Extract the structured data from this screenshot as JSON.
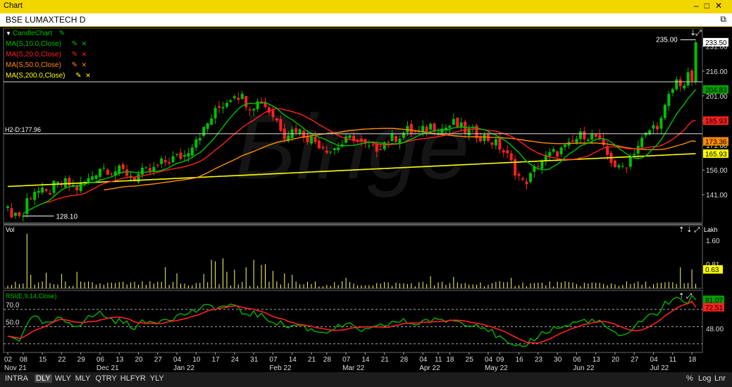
{
  "window": {
    "title": "Chart",
    "controls": [
      "–",
      "□",
      "✕"
    ]
  },
  "symbol": {
    "label": "BSE LUMAXTECH D"
  },
  "legend": [
    {
      "label": "CandleChart",
      "color": "#00c000"
    },
    {
      "label": "MA(S,10.0,Close)",
      "color": "#00c000"
    },
    {
      "label": "MA(S,20.0,Close)",
      "color": "#ff2020"
    },
    {
      "label": "MA(S,50.0,Close)",
      "color": "#ff8c00"
    },
    {
      "label": "MA(S,200.0,Close)",
      "color": "#ffff00"
    }
  ],
  "panels": {
    "volume": {
      "label": "Vol",
      "unit": "Lakh"
    },
    "rsi": {
      "label": "RSI(E,9,14,Close)"
    }
  },
  "watermark": "Binge",
  "chart_data": [
    {
      "type": "candlestick",
      "axis": {
        "ylim": [
          124,
          242
        ],
        "ticks": [
          141.0,
          156.0,
          171.0,
          186.0,
          201.0,
          216.0,
          231.0
        ]
      },
      "date_labels": [
        {
          "i": 0,
          "d": "02",
          "m": "Nov 21"
        },
        {
          "i": 4,
          "d": "08"
        },
        {
          "i": 9,
          "d": "15"
        },
        {
          "i": 14,
          "d": "22"
        },
        {
          "i": 19,
          "d": "29"
        },
        {
          "i": 24,
          "d": "06",
          "m": "Dec 21"
        },
        {
          "i": 29,
          "d": "13"
        },
        {
          "i": 34,
          "d": "20"
        },
        {
          "i": 39,
          "d": "27"
        },
        {
          "i": 44,
          "d": "04",
          "m": "Jan 22"
        },
        {
          "i": 49,
          "d": "10"
        },
        {
          "i": 54,
          "d": "17"
        },
        {
          "i": 59,
          "d": "24"
        },
        {
          "i": 64,
          "d": "31"
        },
        {
          "i": 69,
          "d": "07",
          "m": "Feb 22"
        },
        {
          "i": 74,
          "d": "14"
        },
        {
          "i": 79,
          "d": "21"
        },
        {
          "i": 83,
          "d": "28"
        },
        {
          "i": 88,
          "d": "07",
          "m": "Mar 22"
        },
        {
          "i": 93,
          "d": "14"
        },
        {
          "i": 98,
          "d": "21"
        },
        {
          "i": 103,
          "d": "28"
        },
        {
          "i": 108,
          "d": "04",
          "m": "Apr 22"
        },
        {
          "i": 112,
          "d": "11"
        },
        {
          "i": 115,
          "d": "18"
        },
        {
          "i": 120,
          "d": "25"
        },
        {
          "i": 125,
          "d": "04",
          "m": "May 22"
        },
        {
          "i": 128,
          "d": "09"
        },
        {
          "i": 133,
          "d": "16"
        },
        {
          "i": 138,
          "d": "23"
        },
        {
          "i": 143,
          "d": "30"
        },
        {
          "i": 148,
          "d": "06",
          "m": "Jun 22"
        },
        {
          "i": 153,
          "d": "13"
        },
        {
          "i": 158,
          "d": "20"
        },
        {
          "i": 163,
          "d": "27"
        },
        {
          "i": 168,
          "d": "04",
          "m": "Jul 22"
        },
        {
          "i": 173,
          "d": "11"
        },
        {
          "i": 178,
          "d": "18"
        }
      ],
      "annotations": {
        "high_label": "235.00",
        "high_value": 235.0,
        "low_label": "128.10",
        "low_value": 128.1,
        "hline_label": "H2-D:177.96",
        "hline_value": 177.96,
        "hline2_value": 209.5
      },
      "last_values": [
        {
          "label": "233.50",
          "value": 233.5,
          "bg": "#ffffff",
          "fg": "#000000"
        },
        {
          "label": "204.83",
          "value": 204.83,
          "bg": "#00a000",
          "fg": "#000000"
        },
        {
          "label": "185.93",
          "value": 185.93,
          "bg": "#ff2020",
          "fg": "#000000"
        },
        {
          "label": "173.36",
          "value": 173.36,
          "bg": "#ff8c00",
          "fg": "#000000"
        },
        {
          "label": "165.93",
          "value": 165.93,
          "bg": "#ffff00",
          "fg": "#000000"
        }
      ],
      "colors": {
        "up": "#00c000",
        "down": "#ff2020"
      },
      "waypoints": [
        [
          0,
          131
        ],
        [
          3,
          129
        ],
        [
          4,
          128.5
        ],
        [
          5,
          138
        ],
        [
          7,
          144
        ],
        [
          10,
          141
        ],
        [
          12,
          146
        ],
        [
          15,
          148
        ],
        [
          18,
          145
        ],
        [
          21,
          150
        ],
        [
          24,
          158
        ],
        [
          27,
          156
        ],
        [
          30,
          155
        ],
        [
          33,
          152
        ],
        [
          35,
          154
        ],
        [
          38,
          156
        ],
        [
          40,
          160
        ],
        [
          43,
          163
        ],
        [
          46,
          165
        ],
        [
          49,
          176
        ],
        [
          51,
          180
        ],
        [
          53,
          188
        ],
        [
          55,
          194
        ],
        [
          57,
          198
        ],
        [
          59,
          203
        ],
        [
          61,
          200
        ],
        [
          63,
          195
        ],
        [
          66,
          198
        ],
        [
          68,
          192
        ],
        [
          70,
          186
        ],
        [
          72,
          178
        ],
        [
          75,
          181
        ],
        [
          78,
          176
        ],
        [
          81,
          172
        ],
        [
          84,
          168
        ],
        [
          87,
          172
        ],
        [
          90,
          176
        ],
        [
          93,
          170
        ],
        [
          95,
          168
        ],
        [
          98,
          173
        ],
        [
          101,
          176
        ],
        [
          104,
          180
        ],
        [
          107,
          178
        ],
        [
          110,
          183
        ],
        [
          113,
          181
        ],
        [
          116,
          184
        ],
        [
          119,
          180
        ],
        [
          122,
          178
        ],
        [
          125,
          175
        ],
        [
          128,
          170
        ],
        [
          130,
          164
        ],
        [
          132,
          156
        ],
        [
          134,
          148
        ],
        [
          136,
          152
        ],
        [
          138,
          160
        ],
        [
          141,
          165
        ],
        [
          144,
          168
        ],
        [
          146,
          170
        ],
        [
          148,
          175
        ],
        [
          150,
          178
        ],
        [
          153,
          176
        ],
        [
          155,
          168
        ],
        [
          157,
          162
        ],
        [
          159,
          156
        ],
        [
          161,
          160
        ],
        [
          163,
          168
        ],
        [
          165,
          174
        ],
        [
          167,
          180
        ],
        [
          170,
          186
        ],
        [
          172,
          200
        ],
        [
          174,
          210
        ],
        [
          176,
          208
        ],
        [
          177,
          212
        ],
        [
          178,
          233.5
        ]
      ]
    },
    {
      "type": "bar",
      "name": "Vol",
      "axis": {
        "ylim": [
          0,
          1.95
        ],
        "ticks": [
          0.81,
          1.6
        ]
      },
      "last_label": "0.63",
      "last_value": 0.63,
      "spikes": [
        {
          "i": 5,
          "v": 1.82
        },
        {
          "i": 6,
          "v": 0.45
        },
        {
          "i": 10,
          "v": 0.52
        },
        {
          "i": 14,
          "v": 0.48
        },
        {
          "i": 18,
          "v": 0.55
        },
        {
          "i": 41,
          "v": 0.7
        },
        {
          "i": 44,
          "v": 0.5
        },
        {
          "i": 51,
          "v": 0.48
        },
        {
          "i": 53,
          "v": 0.95
        },
        {
          "i": 54,
          "v": 0.9
        },
        {
          "i": 56,
          "v": 1.0
        },
        {
          "i": 57,
          "v": 0.55
        },
        {
          "i": 59,
          "v": 0.62
        },
        {
          "i": 62,
          "v": 0.7
        },
        {
          "i": 64,
          "v": 0.95
        },
        {
          "i": 66,
          "v": 0.78
        },
        {
          "i": 67,
          "v": 0.8
        },
        {
          "i": 69,
          "v": 0.58
        },
        {
          "i": 72,
          "v": 0.5
        },
        {
          "i": 74,
          "v": 0.45
        },
        {
          "i": 88,
          "v": 0.35
        },
        {
          "i": 110,
          "v": 0.4
        },
        {
          "i": 116,
          "v": 0.38
        },
        {
          "i": 131,
          "v": 0.35
        },
        {
          "i": 175,
          "v": 0.7
        },
        {
          "i": 178,
          "v": 0.63
        }
      ]
    },
    {
      "type": "line",
      "name": "RSI",
      "axis": {
        "ylim": [
          20,
          92
        ],
        "ticks": [
          48.0,
          81.07,
          72.51
        ],
        "left_ticks": [
          70.0,
          50.0
        ]
      },
      "last_values": [
        {
          "label": "81.07",
          "value": 81.07,
          "bg": "#00a000"
        },
        {
          "label": "72.51",
          "value": 72.51,
          "bg": "#ff2020"
        }
      ],
      "levels": [
        30,
        70,
        50
      ],
      "waypoints": [
        [
          0,
          38
        ],
        [
          3,
          35
        ],
        [
          5,
          55
        ],
        [
          7,
          60
        ],
        [
          10,
          52
        ],
        [
          13,
          58
        ],
        [
          15,
          56
        ],
        [
          18,
          52
        ],
        [
          21,
          60
        ],
        [
          24,
          66
        ],
        [
          27,
          58
        ],
        [
          30,
          55
        ],
        [
          33,
          50
        ],
        [
          35,
          54
        ],
        [
          38,
          56
        ],
        [
          41,
          60
        ],
        [
          44,
          62
        ],
        [
          47,
          66
        ],
        [
          50,
          70
        ],
        [
          53,
          74
        ],
        [
          55,
          72
        ],
        [
          58,
          75
        ],
        [
          61,
          66
        ],
        [
          64,
          65
        ],
        [
          67,
          60
        ],
        [
          70,
          55
        ],
        [
          73,
          50
        ],
        [
          76,
          52
        ],
        [
          79,
          46
        ],
        [
          82,
          44
        ],
        [
          85,
          48
        ],
        [
          88,
          52
        ],
        [
          91,
          47
        ],
        [
          94,
          45
        ],
        [
          97,
          50
        ],
        [
          100,
          55
        ],
        [
          103,
          56
        ],
        [
          106,
          53
        ],
        [
          109,
          58
        ],
        [
          112,
          56
        ],
        [
          115,
          58
        ],
        [
          118,
          55
        ],
        [
          121,
          54
        ],
        [
          124,
          50
        ],
        [
          127,
          40
        ],
        [
          130,
          30
        ],
        [
          132,
          24
        ],
        [
          134,
          26
        ],
        [
          136,
          34
        ],
        [
          139,
          42
        ],
        [
          142,
          48
        ],
        [
          145,
          50
        ],
        [
          148,
          55
        ],
        [
          151,
          58
        ],
        [
          154,
          54
        ],
        [
          157,
          46
        ],
        [
          159,
          36
        ],
        [
          161,
          40
        ],
        [
          163,
          52
        ],
        [
          166,
          60
        ],
        [
          169,
          66
        ],
        [
          171,
          76
        ],
        [
          173,
          82
        ],
        [
          175,
          80
        ],
        [
          177,
          78
        ],
        [
          178,
          88
        ]
      ]
    }
  ],
  "bottom": {
    "timeframes": [
      "INTRA",
      "DLY",
      "WLY",
      "MLY",
      "QTRY",
      "HLFYR",
      "YLY"
    ],
    "selected": "DLY",
    "right": [
      "%",
      "Log",
      "Lnr"
    ]
  }
}
